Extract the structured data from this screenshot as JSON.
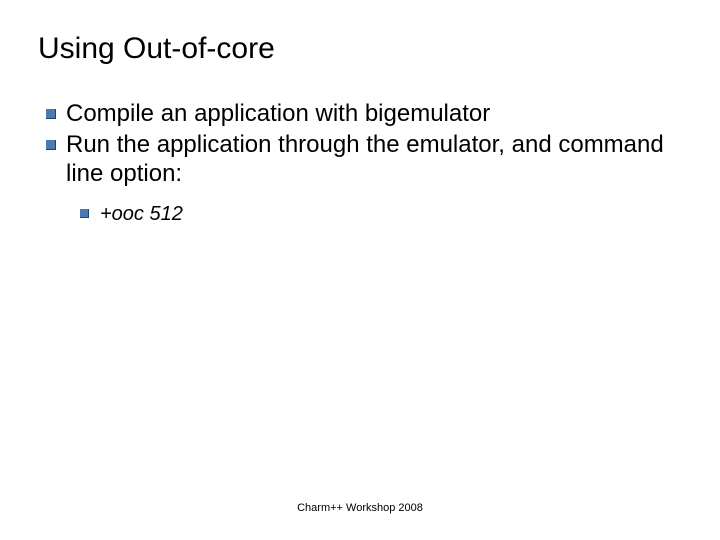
{
  "slide": {
    "title": "Using Out-of-core",
    "bullets": [
      {
        "text": "Compile an application with bigemulator"
      },
      {
        "text": "Run the application through the emulator, and command line option:"
      }
    ],
    "sub_bullets": [
      {
        "text": "+ooc  512"
      }
    ],
    "footer": "Charm++ Workshop 2008"
  },
  "icons": {
    "bullet_color": "#4a7ab6"
  }
}
